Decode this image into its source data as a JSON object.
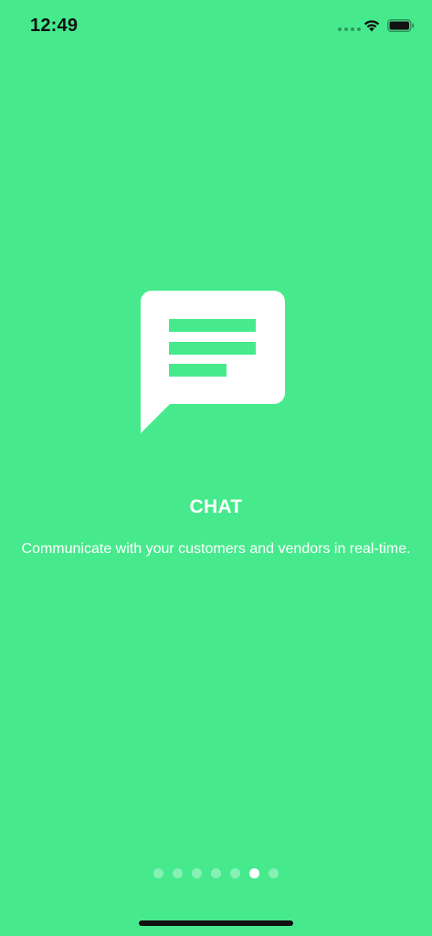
{
  "status_bar": {
    "time": "12:49"
  },
  "onboarding": {
    "icon": "chat-bubble-icon",
    "title": "CHAT",
    "description": "Communicate with your customers and vendors in real-time."
  },
  "pagination": {
    "total_pages": 7,
    "current_page": 6
  },
  "colors": {
    "background": "#46EA8C",
    "foreground": "#FFFFFF"
  }
}
